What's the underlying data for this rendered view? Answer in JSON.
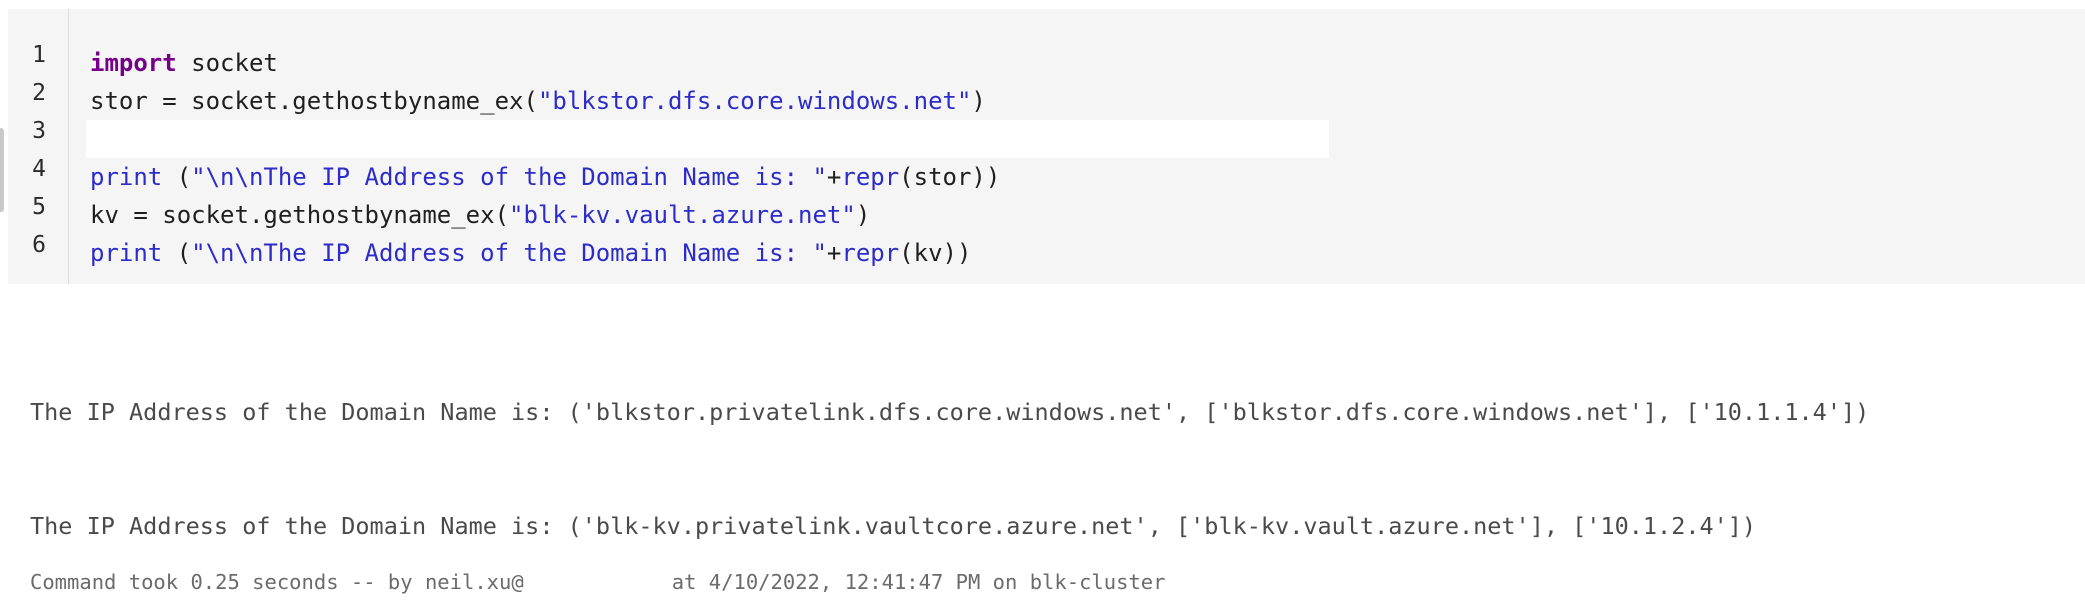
{
  "code": {
    "line_numbers": [
      "1",
      "2",
      "3",
      "4",
      "5",
      "6"
    ],
    "line1": {
      "keyword": "import",
      "rest": " socket"
    },
    "line2": {
      "prefix": "stor = socket.gethostbyname_ex(",
      "string": "\"blkstor.dfs.core.windows.net\"",
      "suffix": ")"
    },
    "line3": "",
    "line4": {
      "func": "print",
      "mid": " (",
      "string": "\"\\n\\nThe IP Address of the Domain Name is: \"",
      "plus": "+",
      "repr": "repr",
      "suffix": "(stor))"
    },
    "line5": {
      "prefix": "kv = socket.gethostbyname_ex(",
      "string": "\"blk-kv.vault.azure.net\"",
      "suffix": ")"
    },
    "line6": {
      "func": "print",
      "mid": " (",
      "string": "\"\\n\\nThe IP Address of the Domain Name is: \"",
      "plus": "+",
      "repr": "repr",
      "suffix": "(kv))"
    }
  },
  "output": {
    "line1": "The IP Address of the Domain Name is: ('blkstor.privatelink.dfs.core.windows.net', ['blkstor.dfs.core.windows.net'], ['10.1.1.4'])",
    "line2": "The IP Address of the Domain Name is: ('blk-kv.privatelink.vaultcore.azure.net', ['blk-kv.vault.azure.net'], ['10.1.2.4'])"
  },
  "status": {
    "text": "Command took 0.25 seconds -- by neil.xu@            at 4/10/2022, 12:41:47 PM on blk-cluster"
  },
  "colors": {
    "editor_bg": "#f5f5f5",
    "keyword": "#770088",
    "string": "#2c2cc9",
    "output_text": "#4a4a4a"
  }
}
